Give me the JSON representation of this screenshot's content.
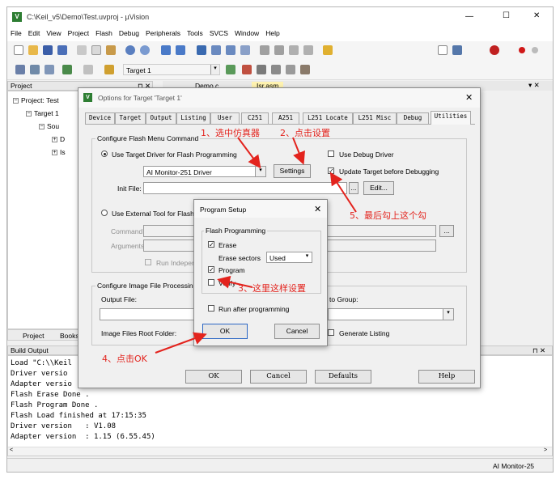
{
  "app": {
    "title": "C:\\Keil_v5\\Demo\\Test.uvproj - µVision",
    "window_buttons": [
      "—",
      "☐",
      "✕"
    ]
  },
  "menu": [
    "File",
    "Edit",
    "View",
    "Project",
    "Flash",
    "Debug",
    "Peripherals",
    "Tools",
    "SVCS",
    "Window",
    "Help"
  ],
  "toolbar": {
    "target_name": "Target 1"
  },
  "project_panel": {
    "title": "Project",
    "pin": "⊓ ✕",
    "tree": {
      "root": "Project: Test",
      "target": "Target 1",
      "group": "Sou",
      "file1": "D",
      "file2": "Is"
    },
    "bottom_tabs": [
      "Project",
      "Books"
    ]
  },
  "editor_tabs": [
    "Demo.c",
    "Isr.asm"
  ],
  "build_output": {
    "title": "Build Output",
    "lines": [
      "Load \"C:\\\\Keil",
      "Driver versio",
      "Adapter versio",
      "Flash Erase Done .",
      "Flash Program Done .",
      "Flash Load finished at 17:15:35",
      "Driver version   : V1.08",
      "Adapter version  : 1.15 (6.55.45)"
    ]
  },
  "status_bar": {
    "driver": "AI Monitor-25"
  },
  "options_dialog": {
    "title": "Options for Target 'Target 1'",
    "tabs": [
      "Device",
      "Target",
      "Output",
      "Listing",
      "User",
      "C251",
      "A251",
      "L251 Locate",
      "L251 Misc",
      "Debug",
      "Utilities"
    ],
    "active_tab": "Utilities",
    "configure_group": "Configure Flash Menu Command",
    "use_target_driver": "Use Target Driver for Flash Programming",
    "driver_select": "AI Monitor-251 Driver",
    "settings_button": "Settings",
    "use_debug_driver": "Use Debug Driver",
    "update_target": "Update Target before Debugging",
    "init_file_label": "Init File:",
    "browse_button": "...",
    "edit_button": "Edit...",
    "use_external_tool": "Use External Tool for Flash",
    "command_label": "Command:",
    "arguments_label": "Arguments:",
    "run_independent": "Run Indepen",
    "image_group": "Configure Image File Processing",
    "output_file_label": "Output File:",
    "add_to_group_label": "to Group:",
    "image_root_label": "Image Files Root Folder:",
    "generate_listing": "Generate Listing",
    "ok_button": "OK",
    "cancel_button": "Cancel",
    "defaults_button": "Defaults",
    "help_button": "Help"
  },
  "program_setup": {
    "title": "Program Setup",
    "group": "Flash Programming",
    "erase": "Erase",
    "erase_sectors_label": "Erase sectors",
    "erase_sectors_value": "Used",
    "program": "Program",
    "verify": "Verify",
    "run_after": "Run after programming",
    "ok_button": "OK",
    "cancel_button": "Cancel",
    "erase_checked": true,
    "program_checked": true,
    "verify_checked": false,
    "run_after_checked": false
  },
  "annotations": {
    "step1": "1、选中仿真器",
    "step2": "2、点击设置",
    "step3": "3、这里这样设置",
    "step4": "4、点击OK",
    "step5": "5、最后勾上这个勾",
    "color": "#e3231d"
  }
}
